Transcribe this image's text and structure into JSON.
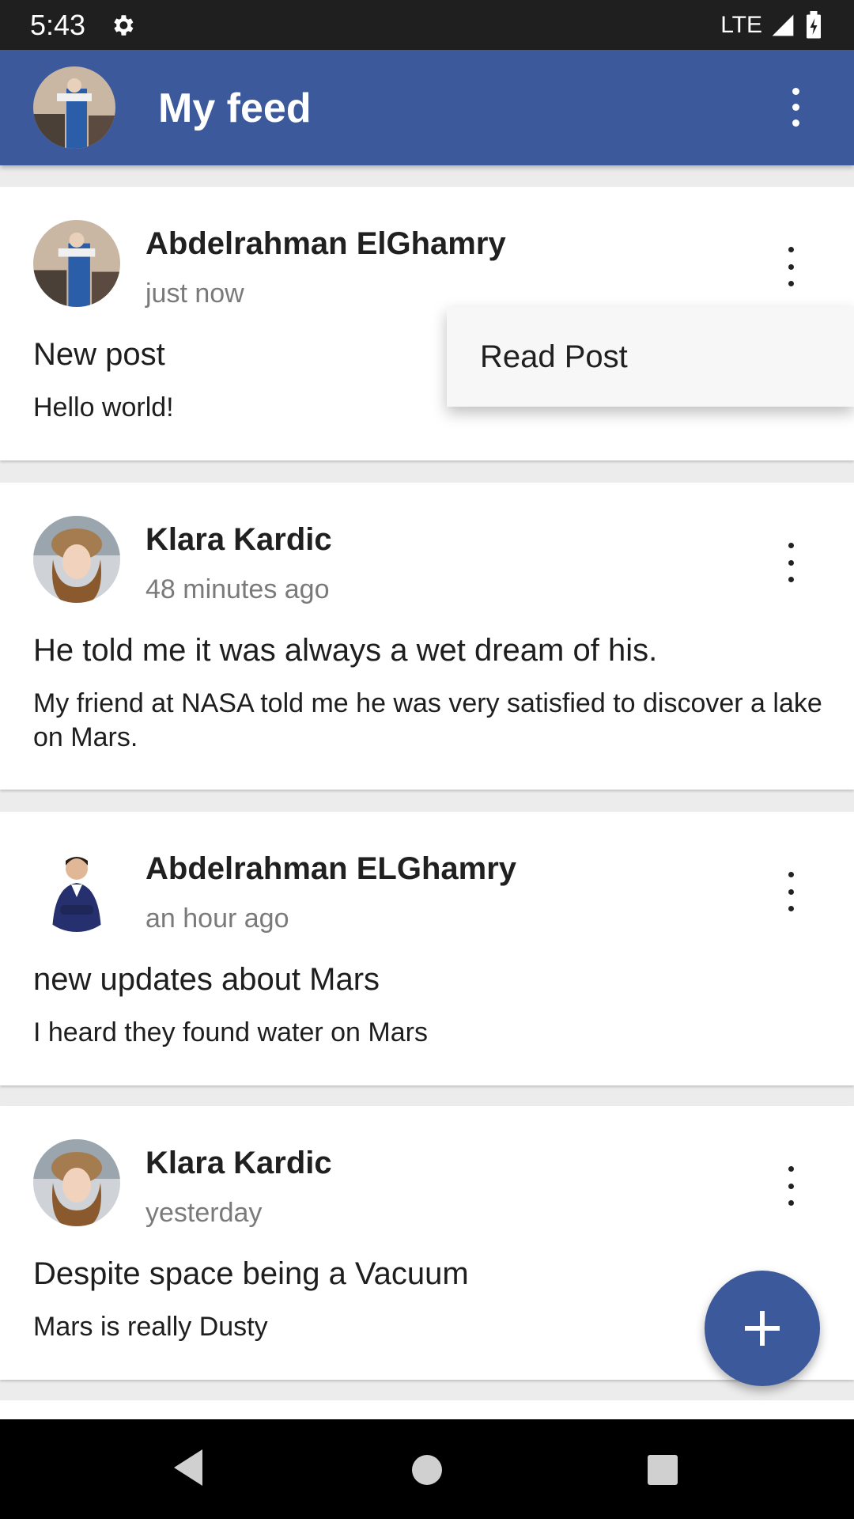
{
  "status_bar": {
    "time": "5:43",
    "network": "LTE",
    "icons": [
      "gear-icon",
      "signal-icon",
      "battery-charging-icon"
    ]
  },
  "app_bar": {
    "title": "My feed",
    "avatar_icon": "user-avatar",
    "menu_icon": "more-vertical-icon",
    "color": "#3c5a9b"
  },
  "popup_menu": {
    "item": "Read Post"
  },
  "posts": [
    {
      "author": "Abdelrahman ElGhamry",
      "time": "just now",
      "title": "New post",
      "body": "Hello world!"
    },
    {
      "author": "Klara Kardic",
      "time": "48 minutes ago",
      "title": "He told me it was always a wet dream of his.",
      "body": "My friend at NASA told me he was very satisfied to discover a lake on Mars."
    },
    {
      "author": "Abdelrahman ELGhamry",
      "time": "an hour ago",
      "title": "new updates about Mars",
      "body": "I heard they found water on Mars"
    },
    {
      "author": "Klara Kardic",
      "time": "yesterday",
      "title": "Despite space being a Vacuum",
      "body": "Mars is really Dusty"
    }
  ],
  "fab": {
    "icon": "plus-icon"
  },
  "nav_bar": {
    "icons": [
      "back-icon",
      "home-icon",
      "recents-icon"
    ]
  }
}
